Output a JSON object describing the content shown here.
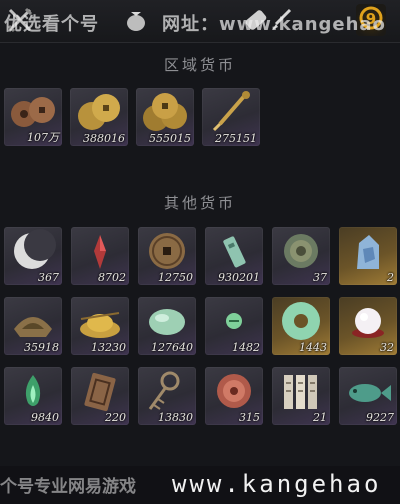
{
  "watermark_top": {
    "left": "优选看个号",
    "right": "网址：www.kangehao"
  },
  "watermark_bottom": {
    "left": "个号专业网易游戏",
    "right": "www.kangehao"
  },
  "topbar": {
    "icons": [
      "crossed-swords-icon",
      "money-bag-icon",
      "scroll-icon",
      "brush-icon",
      "currency-icon"
    ],
    "active_tab_badge": "9"
  },
  "sections": [
    {
      "title": "区域货币"
    },
    {
      "title": "其他货币"
    }
  ],
  "regional": [
    {
      "name": "copper-coins-icon",
      "qty": "107万"
    },
    {
      "name": "gold-coins-icon",
      "qty": "388016"
    },
    {
      "name": "gold-coins-stack-icon",
      "qty": "555015"
    },
    {
      "name": "dagger-token-icon",
      "qty": "275151"
    }
  ],
  "other": [
    {
      "name": "crescent-moon-icon",
      "qty": "367",
      "gold": false
    },
    {
      "name": "red-crystal-icon",
      "qty": "8702",
      "gold": false
    },
    {
      "name": "square-hole-coin-icon",
      "qty": "12750",
      "gold": false
    },
    {
      "name": "jade-tag-icon",
      "qty": "930201",
      "gold": false
    },
    {
      "name": "bronze-medallion-icon",
      "qty": "37",
      "gold": false
    },
    {
      "name": "blue-jade-stone-icon",
      "qty": "2",
      "gold": true
    },
    {
      "name": "boat-ingot-icon",
      "qty": "35918",
      "gold": false
    },
    {
      "name": "gold-grain-pile-icon",
      "qty": "13230",
      "gold": false
    },
    {
      "name": "jade-pebble-icon",
      "qty": "127640",
      "gold": false
    },
    {
      "name": "jade-bead-icon",
      "qty": "1482",
      "gold": false
    },
    {
      "name": "jade-disc-icon",
      "qty": "1443",
      "gold": true
    },
    {
      "name": "pearl-icon",
      "qty": "32",
      "gold": true
    },
    {
      "name": "green-flame-icon",
      "qty": "9840",
      "gold": false
    },
    {
      "name": "stamped-plaque-icon",
      "qty": "220",
      "gold": false
    },
    {
      "name": "coin-string-icon",
      "qty": "13830",
      "gold": false
    },
    {
      "name": "red-seal-coin-icon",
      "qty": "315",
      "gold": false
    },
    {
      "name": "bamboo-slips-icon",
      "qty": "21",
      "gold": false
    },
    {
      "name": "jade-fish-icon",
      "qty": "9227",
      "gold": false
    }
  ]
}
